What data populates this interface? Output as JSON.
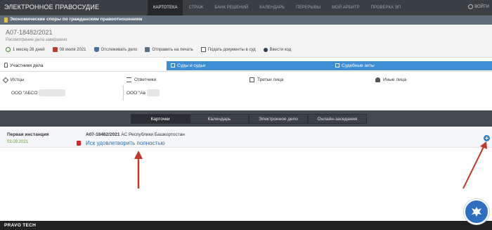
{
  "header": {
    "app_title": "ЭЛЕКТРОННОЕ ПРАВОСУДИЕ",
    "nav": [
      {
        "label": "КАРТОТЕКА",
        "active": true
      },
      {
        "label": "СТРАЖ",
        "active": false
      },
      {
        "label": "БАНК РЕШЕНИЙ",
        "active": false
      },
      {
        "label": "КАЛЕНДАРЬ",
        "active": false
      },
      {
        "label": "ПЕРЕРЫВЫ",
        "active": false
      },
      {
        "label": "МОЙ АРБИТР",
        "active": false
      },
      {
        "label": "ПРОВЕРКА ЭП",
        "active": false
      }
    ],
    "exit_label": "ВОЙТИ"
  },
  "category": {
    "label": "Экономические споры по гражданским правоотношениям"
  },
  "case": {
    "number": "А07-18482/2021",
    "status": "Рассмотрение дела завершено",
    "meta": [
      {
        "icon": "clock-icon",
        "label": "1 месяц 26 дней"
      },
      {
        "icon": "calendar-icon",
        "label": "08 июля 2021"
      },
      {
        "icon": "shield-icon",
        "label": "Отслеживать дело"
      },
      {
        "icon": "printer-icon",
        "label": "Отправить на печать"
      },
      {
        "icon": "document-icon",
        "label": "Подать документы в суд"
      },
      {
        "icon": "key-icon",
        "label": "Ввести код"
      }
    ]
  },
  "tabs": {
    "participants": "Участники дела",
    "courts": "Суды и судьи",
    "acts": "Судебные акты"
  },
  "parties": {
    "plaintiffs_label": "Истцы",
    "plaintiff_value": "ООО \"АБСО",
    "defendants_label": "Ответчики",
    "defendant_value": "ООО \"Ав",
    "third_label": "Третьи лица",
    "other_label": "Иные лица"
  },
  "view_buttons": {
    "cards": "Карточки",
    "calendar": "Календарь",
    "electronic_case": "Электронное дело",
    "online": "Онлайн-заседания"
  },
  "instance": {
    "title": "Первая инстанция",
    "date": "03.09.2021",
    "case_number": "А07-18482/2021",
    "court": "АС Республики Башкортостан",
    "decision": "Иск удовлетворить полностью"
  },
  "footer": {
    "brand": "PRAVO TECH"
  },
  "colors": {
    "topbar": "#3a3f44",
    "category_bar": "#5f6d7b",
    "tab_blue": "#3e8ed6",
    "link_blue": "#2c6fb2",
    "annotation_red": "#c0392b",
    "date_green": "#6a9b3a"
  }
}
